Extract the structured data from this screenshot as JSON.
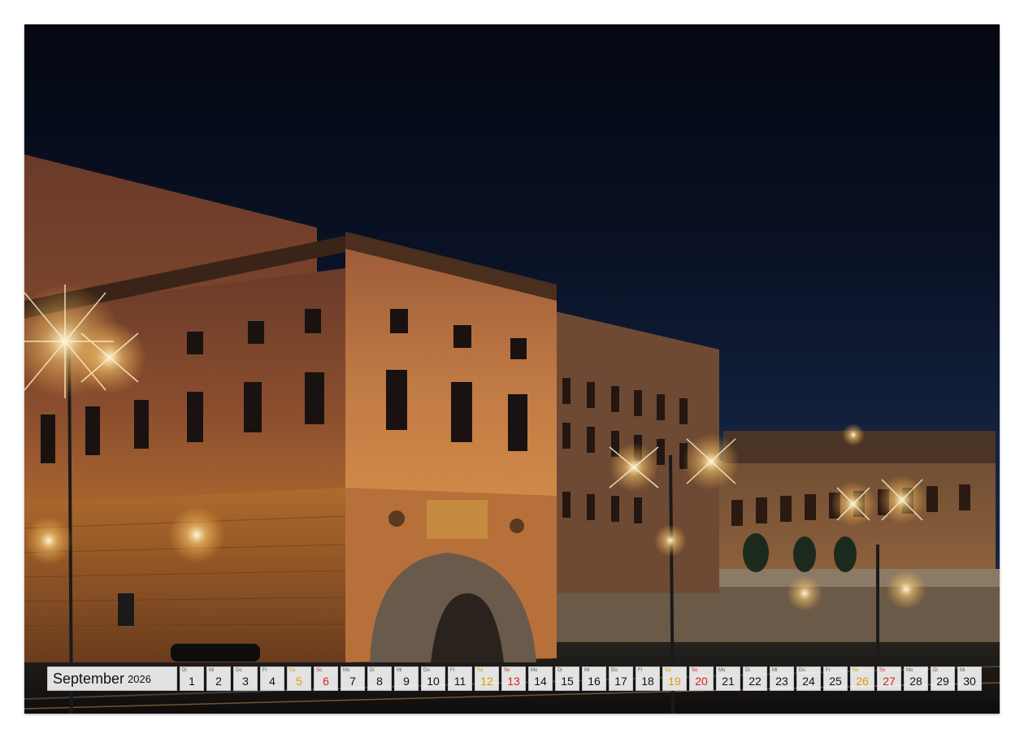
{
  "calendar": {
    "month": "September",
    "year": "2026",
    "days": [
      {
        "wd": "Di",
        "n": "1",
        "t": "w"
      },
      {
        "wd": "Mi",
        "n": "2",
        "t": "w"
      },
      {
        "wd": "Do",
        "n": "3",
        "t": "w"
      },
      {
        "wd": "Fr",
        "n": "4",
        "t": "w"
      },
      {
        "wd": "Sa",
        "n": "5",
        "t": "sat"
      },
      {
        "wd": "So",
        "n": "6",
        "t": "sun"
      },
      {
        "wd": "Mo",
        "n": "7",
        "t": "w"
      },
      {
        "wd": "Di",
        "n": "8",
        "t": "w"
      },
      {
        "wd": "Mi",
        "n": "9",
        "t": "w"
      },
      {
        "wd": "Do",
        "n": "10",
        "t": "w"
      },
      {
        "wd": "Fr",
        "n": "11",
        "t": "w"
      },
      {
        "wd": "Sa",
        "n": "12",
        "t": "sat"
      },
      {
        "wd": "So",
        "n": "13",
        "t": "sun"
      },
      {
        "wd": "Mo",
        "n": "14",
        "t": "w"
      },
      {
        "wd": "Di",
        "n": "15",
        "t": "w"
      },
      {
        "wd": "Mi",
        "n": "16",
        "t": "w"
      },
      {
        "wd": "Do",
        "n": "17",
        "t": "w"
      },
      {
        "wd": "Fr",
        "n": "18",
        "t": "w"
      },
      {
        "wd": "Sa",
        "n": "19",
        "t": "sat"
      },
      {
        "wd": "So",
        "n": "20",
        "t": "sun"
      },
      {
        "wd": "Mo",
        "n": "21",
        "t": "w"
      },
      {
        "wd": "Di",
        "n": "22",
        "t": "w"
      },
      {
        "wd": "Mi",
        "n": "23",
        "t": "w"
      },
      {
        "wd": "Do",
        "n": "24",
        "t": "w"
      },
      {
        "wd": "Fr",
        "n": "25",
        "t": "w"
      },
      {
        "wd": "Sa",
        "n": "26",
        "t": "sat"
      },
      {
        "wd": "So",
        "n": "27",
        "t": "sun"
      },
      {
        "wd": "Mo",
        "n": "28",
        "t": "w"
      },
      {
        "wd": "Di",
        "n": "29",
        "t": "w"
      },
      {
        "wd": "Mi",
        "n": "30",
        "t": "w"
      }
    ]
  },
  "colors": {
    "saturday": "#e39a00",
    "sunday": "#d6231d",
    "weekday": "#111111"
  },
  "photo": {
    "subject": "palace-night-icon"
  }
}
